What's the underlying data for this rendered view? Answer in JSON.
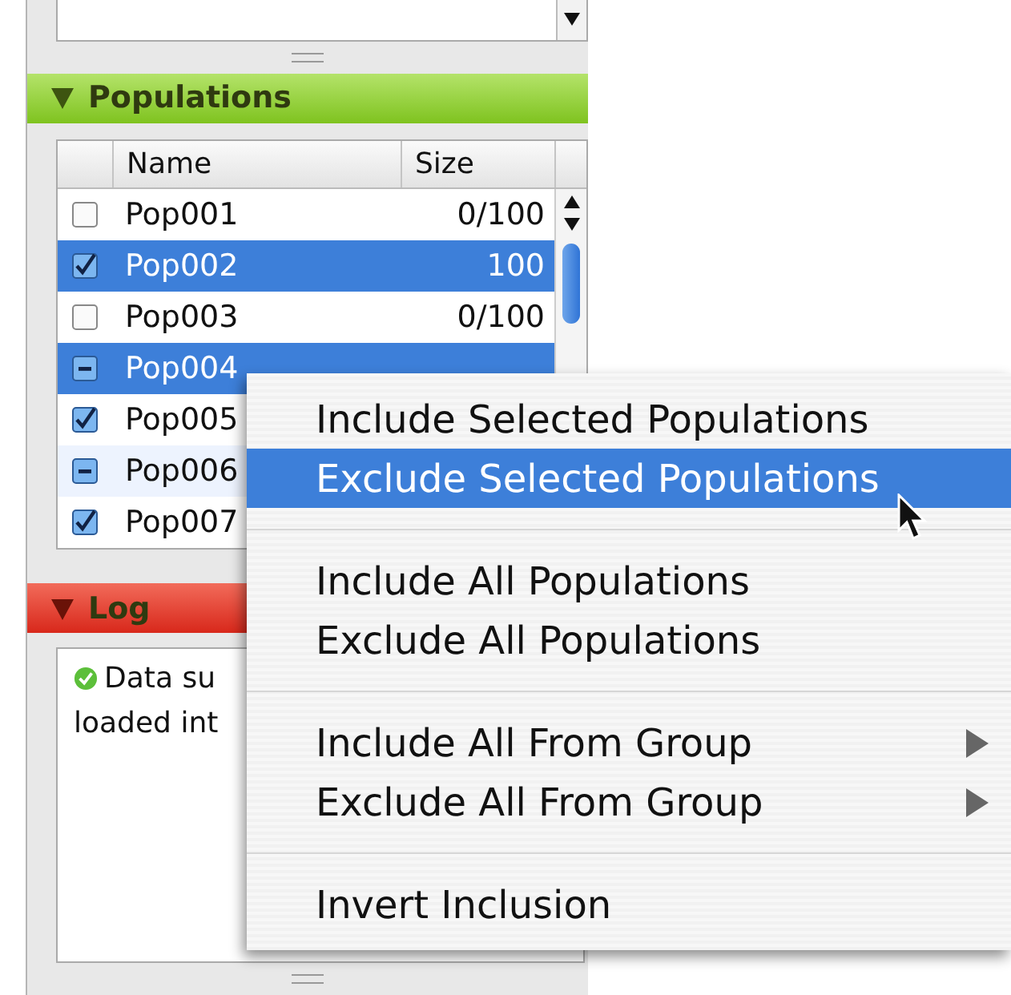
{
  "populations_header": {
    "title": "Populations",
    "expanded": true
  },
  "table": {
    "columns": [
      "Name",
      "Size"
    ],
    "rows": [
      {
        "name": "Pop001",
        "size": "0/100",
        "checked": false,
        "mixed": false,
        "selected": false
      },
      {
        "name": "Pop002",
        "size": "100",
        "checked": true,
        "mixed": false,
        "selected": true
      },
      {
        "name": "Pop003",
        "size": "0/100",
        "checked": false,
        "mixed": false,
        "selected": false
      },
      {
        "name": "Pop004",
        "mixed": true,
        "selected": true
      },
      {
        "name": "Pop005",
        "checked": true,
        "mixed": false,
        "selected": false
      },
      {
        "name": "Pop006",
        "mixed": true,
        "selected": false
      },
      {
        "name": "Pop007",
        "checked": true,
        "mixed": false,
        "selected": false
      }
    ]
  },
  "log_header": {
    "title": "Log",
    "expanded": true
  },
  "log": {
    "lines": [
      "Data su",
      "loaded int"
    ]
  },
  "context_menu": {
    "items": [
      {
        "kind": "item",
        "label": "Include Selected Populations",
        "selected": false,
        "submenu": false
      },
      {
        "kind": "item",
        "label": "Exclude Selected Populations",
        "selected": true,
        "submenu": false
      },
      {
        "kind": "separator"
      },
      {
        "kind": "item",
        "label": "Include All Populations",
        "selected": false,
        "submenu": false
      },
      {
        "kind": "item",
        "label": "Exclude All Populations",
        "selected": false,
        "submenu": false
      },
      {
        "kind": "separator"
      },
      {
        "kind": "item",
        "label": "Include All From Group",
        "selected": false,
        "submenu": true
      },
      {
        "kind": "item",
        "label": "Exclude All From Group",
        "selected": false,
        "submenu": true
      },
      {
        "kind": "separator"
      },
      {
        "kind": "item",
        "label": "Invert Inclusion",
        "selected": false,
        "submenu": false
      }
    ]
  }
}
